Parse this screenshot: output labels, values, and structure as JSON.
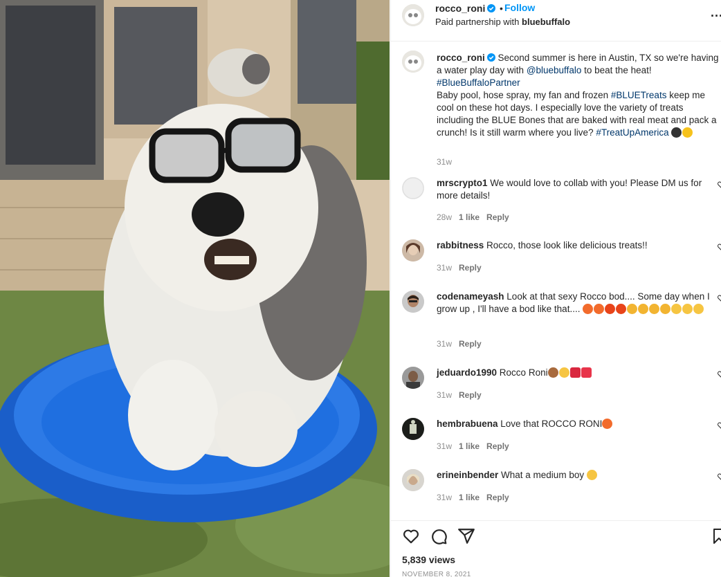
{
  "header": {
    "username": "rocco_roni",
    "dot": "•",
    "follow_label": "Follow",
    "partner_prefix": "Paid partnership with ",
    "partner_name": "bluebuffalo",
    "more": "..."
  },
  "caption": {
    "username": "rocco_roni",
    "text_1": " Second summer is here in Austin, TX so we're having a water play day with ",
    "mention": "@bluebuffalo",
    "text_2": " to beat the heat! ",
    "hashtag_1": "#BlueBuffaloPartner",
    "text_3": "Baby pool, hose spray, my fan and frozen ",
    "hashtag_2": "#BLUETreats",
    "text_4": " keep me cool on these hot days. I especially love the variety of treats including the BLUE Bones that are baked with real meat and pack a crunch! Is it still warm where you live? ",
    "hashtag_3": "#TreatUpAmerica",
    "age": "31w"
  },
  "comments": [
    {
      "username": "mrscrypto1",
      "text": " We would love to collab with you! Please DM us for more details!",
      "age": "28w",
      "likes": "1 like",
      "reply": "Reply"
    },
    {
      "username": "rabbitness",
      "text": " Rocco, those look like delicious treats!!",
      "age": "31w",
      "likes": "",
      "reply": "Reply"
    },
    {
      "username": "codenameyash",
      "text": " Look at that sexy Rocco bod.... Some day when I grow up , I'll have a bod like that.... ",
      "age": "31w",
      "likes": "",
      "reply": "Reply"
    },
    {
      "username": "jeduardo1990",
      "text": " Rocco Roni",
      "age": "31w",
      "likes": "",
      "reply": "Reply"
    },
    {
      "username": "hembrabuena",
      "text": " Love that ROCCO RONI",
      "age": "31w",
      "likes": "1 like",
      "reply": "Reply"
    },
    {
      "username": "erineinbender",
      "text": " What a medium boy ",
      "age": "31w",
      "likes": "1 like",
      "reply": "Reply"
    }
  ],
  "footer": {
    "views": "5,839 views",
    "date": "NOVEMBER 8, 2021"
  },
  "icons": [
    "heart-icon",
    "comment-icon",
    "share-icon",
    "bookmark-icon",
    "verified-badge-icon",
    "more-options-icon"
  ],
  "colors": {
    "link": "#0095f6",
    "mention": "#00376b",
    "muted": "#8e8e8e",
    "pool_blue": "#1f6fe0"
  }
}
